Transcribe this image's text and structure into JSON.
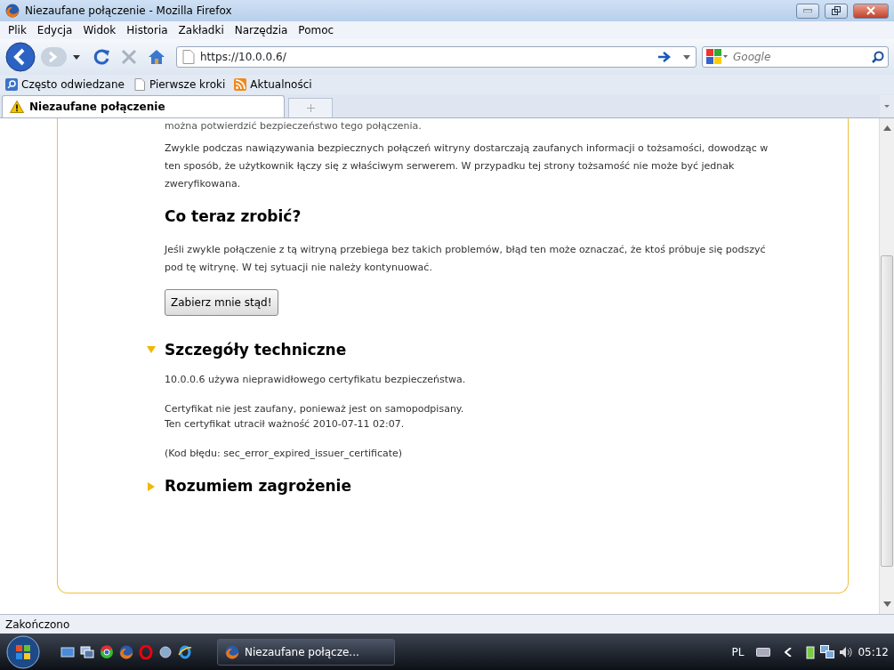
{
  "window": {
    "title": "Niezaufane połączenie - Mozilla Firefox"
  },
  "menu": [
    "Plik",
    "Edycja",
    "Widok",
    "Historia",
    "Zakładki",
    "Narzędzia",
    "Pomoc"
  ],
  "toolbar": {
    "url": "https://10.0.0.6/",
    "search_placeholder": "Google"
  },
  "bookmarks": [
    {
      "label": "Często odwiedzane",
      "kind": "search"
    },
    {
      "label": "Pierwsze kroki",
      "kind": "page"
    },
    {
      "label": "Aktualności",
      "kind": "feed"
    }
  ],
  "tabs": [
    {
      "label": "Niezaufane połączenie",
      "selected": true
    }
  ],
  "content": {
    "cut_line": "można potwierdzić bezpieczeństwo tego połączenia.",
    "paragraph_1": "Zwykle podczas nawiązywania bezpiecznych połączeń witryny dostarczają zaufanych informacji o tożsamości, dowodząc w ten sposób, że użytkownik łączy się z właściwym serwerem. W przypadku tej strony tożsamość nie może być jednak zweryfikowana.",
    "heading": "Co teraz zrobić?",
    "paragraph_2": "Jeśli zwykle połączenie z tą witryną przebiega bez takich problemów, błąd ten może oznaczać, że ktoś próbuje się podszyć pod tę witrynę. W tej sytuacji nie należy kontynuować.",
    "button": "Zabierz mnie stąd!",
    "sections": [
      {
        "title": "Szczegóły techniczne",
        "expanded": true,
        "paragraphs": [
          [
            "10.0.0.6 używa nieprawidłowego certyfikatu bezpieczeństwa."
          ],
          [
            "Certyfikat nie jest zaufany, ponieważ jest on samopodpisany.",
            "Ten certyfikat utracił ważność 2010-07-11 02:07."
          ],
          [
            "(Kod błędu: sec_error_expired_issuer_certificate)"
          ]
        ]
      },
      {
        "title": "Rozumiem zagrożenie",
        "expanded": false
      }
    ]
  },
  "status_bar": "Zakończono",
  "taskbar": {
    "tasks": [
      {
        "label": "Niezaufane połącze...",
        "selected": true
      }
    ],
    "language": "PL",
    "clock": "05:12"
  }
}
